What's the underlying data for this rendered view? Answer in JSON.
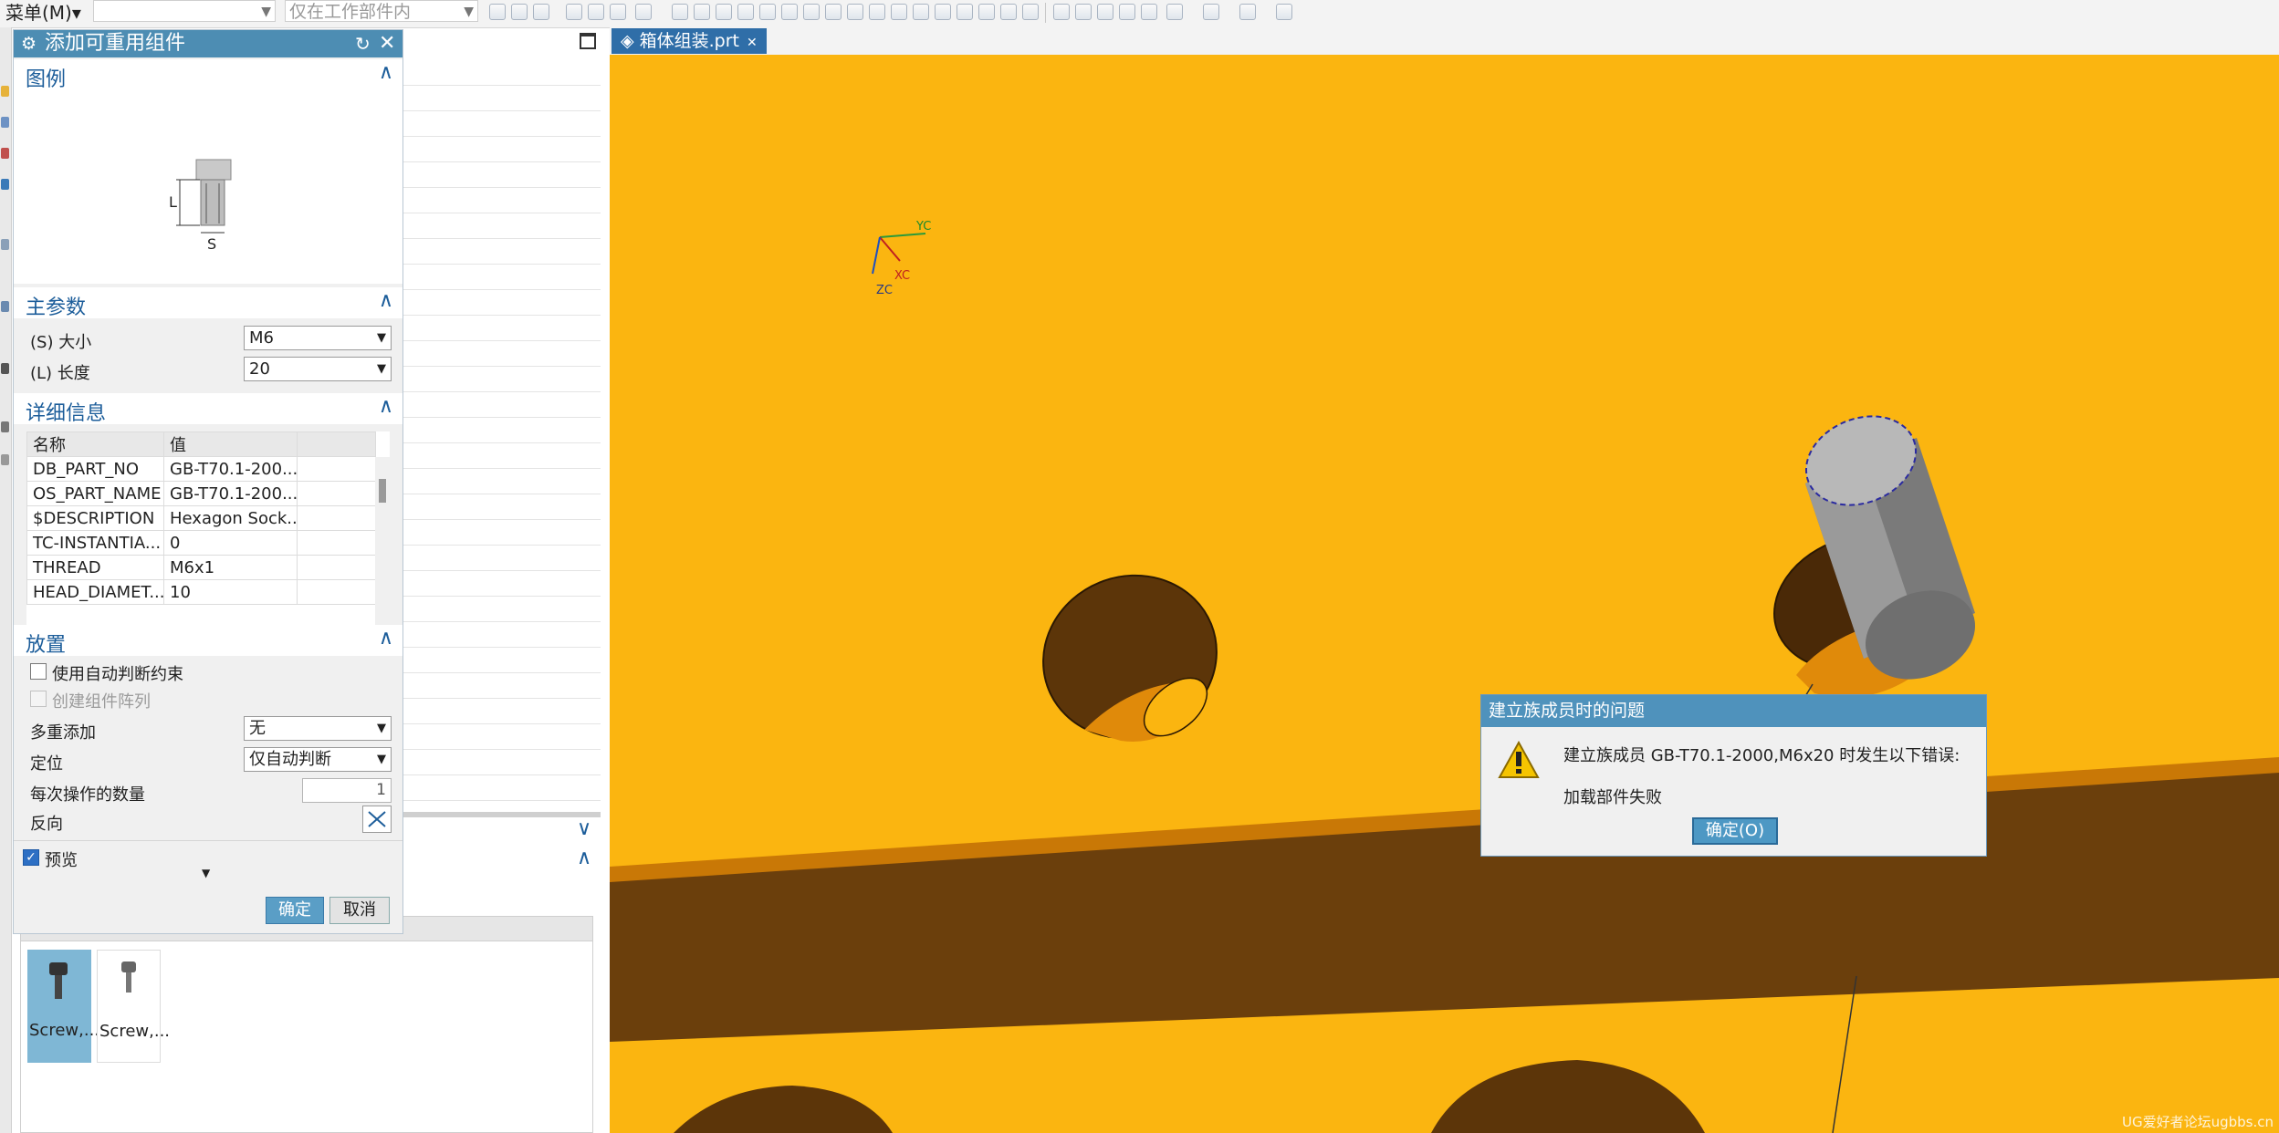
{
  "toolbar": {
    "menu_label": "菜单(M)▾",
    "scope_placeholder": "仅在工作部件内"
  },
  "dialog": {
    "title": "添加可重用组件",
    "legend": {
      "title": "图例",
      "dim_length": "L",
      "dim_size": "S"
    },
    "main_params": {
      "title": "主参数",
      "size_label": "(S) 大小",
      "size_value": "M6",
      "length_label": "(L) 长度",
      "length_value": "20"
    },
    "details": {
      "title": "详细信息",
      "col_name": "名称",
      "col_value": "值",
      "rows": [
        {
          "name": "DB_PART_NO",
          "value": "GB-T70.1-200..."
        },
        {
          "name": "OS_PART_NAME",
          "value": "GB-T70.1-200..."
        },
        {
          "name": "$DESCRIPTION",
          "value": "Hexagon Sock..."
        },
        {
          "name": "TC-INSTANTIA...",
          "value": "0"
        },
        {
          "name": "THREAD",
          "value": "M6x1"
        },
        {
          "name": "HEAD_DIAMET...",
          "value": "10"
        }
      ]
    },
    "placement": {
      "title": "放置",
      "auto_constraint_label": "使用自动判断约束",
      "auto_constraint_checked": false,
      "create_array_label": "创建组件阵列",
      "multi_add_label": "多重添加",
      "multi_add_value": "无",
      "position_label": "定位",
      "position_value": "仅自动判断",
      "count_label": "每次操作的数量",
      "count_value": "1",
      "reverse_label": "反向"
    },
    "preview": {
      "label": "预览",
      "checked": true
    },
    "ok_label": "确定",
    "cancel_label": "取消"
  },
  "library": {
    "items": [
      {
        "label": "Screw,..."
      },
      {
        "label": "Screw,..."
      }
    ]
  },
  "viewport": {
    "tab_label": "箱体组装.prt",
    "csys_labels": {
      "yc": "YC",
      "xc": "XC",
      "zc": "ZC"
    },
    "watermark": "UG爱好者论坛ugbbs.cn"
  },
  "error_dialog": {
    "title": "建立族成员时的问题",
    "message": "建立族成员 GB-T70.1-2000,M6x20 时发生以下错误:",
    "detail": "加载部件失败",
    "ok_label": "确定(O)"
  },
  "colors": {
    "viewport_bg": "#fbb510",
    "dialog_title_bg": "#4d8db3",
    "accent": "#1c5d9a"
  }
}
